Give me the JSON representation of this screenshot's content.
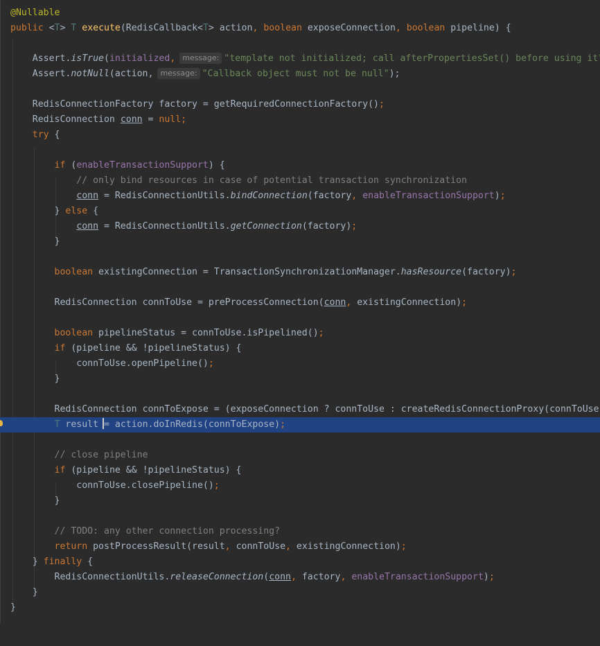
{
  "editor": {
    "language": "Java",
    "highlighted_line": 28,
    "colors": {
      "background": "#2b2b2b",
      "highlight": "#214283",
      "keyword": "#cc7832",
      "annotation": "#bbb529",
      "method_decl": "#ffc66d",
      "field": "#9876aa",
      "string": "#6a8759",
      "comment": "#808080",
      "type_param": "#507874"
    }
  },
  "code": {
    "l1": {
      "annotation": "@Nullable"
    },
    "l2": {
      "kw_public": "public",
      "lt": " <",
      "tp1": "T",
      "gt": "> ",
      "tp2": "T",
      "sp": " ",
      "method": "execute",
      "p1": "(RedisCallback<",
      "tp3": "T",
      "p2": "> action",
      "c1": ", ",
      "kw_boolean1": "boolean",
      "p3": " exposeConnection",
      "c2": ", ",
      "kw_boolean2": "boolean",
      "p4": " pipeline) {"
    },
    "l4": {
      "a": "Assert.",
      "method": "isTrue",
      "b": "(",
      "field": "initialized",
      "c": ",",
      "hint": "message:",
      "str": "\"template not initialized; call afterPropertiesSet() before using it\"",
      "d": ");"
    },
    "l5": {
      "a": "Assert.",
      "method": "notNull",
      "b": "(action,",
      "hint": "message:",
      "str": "\"Callback object must not be null\"",
      "d": ");"
    },
    "l7": {
      "a": "RedisConnectionFactory factory = getRequiredConnectionFactory()",
      "semi": ";"
    },
    "l8": {
      "a": "RedisConnection ",
      "var": "conn",
      "b": " = ",
      "kw_null": "null",
      "semi": ";"
    },
    "l9": {
      "kw_try": "try",
      "b": " {"
    },
    "l11": {
      "kw_if": "if",
      "a": " (",
      "field": "enableTransactionSupport",
      "b": ") {"
    },
    "l12": {
      "comment": "// only bind resources in case of potential transaction synchronization"
    },
    "l13": {
      "var": "conn",
      "a": " = RedisConnectionUtils.",
      "method": "bindConnection",
      "b": "(factory",
      "c": ", ",
      "field": "enableTransactionSupport",
      "d": ")",
      "semi": ";"
    },
    "l14": {
      "a": "} ",
      "kw_else": "else",
      "b": " {"
    },
    "l15": {
      "var": "conn",
      "a": " = RedisConnectionUtils.",
      "method": "getConnection",
      "b": "(factory)",
      "semi": ";"
    },
    "l16": {
      "a": "}"
    },
    "l18": {
      "kw_boolean": "boolean",
      "a": " existingConnection = TransactionSynchronizationManager.",
      "method": "hasResource",
      "b": "(factory)",
      "semi": ";"
    },
    "l20": {
      "a": "RedisConnection connToUse = preProcessConnection(",
      "var": "conn",
      "c": ", ",
      "b": "existingConnection)",
      "semi": ";"
    },
    "l22": {
      "kw_boolean": "boolean",
      "a": " pipelineStatus = connToUse.isPipelined()",
      "semi": ";"
    },
    "l23": {
      "kw_if": "if",
      "a": " (pipeline && !pipelineStatus) {"
    },
    "l24": {
      "a": "connToUse.openPipeline()",
      "semi": ";"
    },
    "l25": {
      "a": "}"
    },
    "l27": {
      "a": "RedisConnection connToExpose = (exposeConnection ? connToUse : createRedisConnectionProxy(connToUse))",
      "semi": ";"
    },
    "l28": {
      "tp": "T",
      "a": " result ",
      "b": "= action.doInRedis(connToExpose)",
      "semi": ";"
    },
    "l30": {
      "comment": "// close pipeline"
    },
    "l31": {
      "kw_if": "if",
      "a": " (pipeline && !pipelineStatus) {"
    },
    "l32": {
      "a": "connToUse.closePipeline()",
      "semi": ";"
    },
    "l33": {
      "a": "}"
    },
    "l35": {
      "comment": "// TODO: any other connection processing?"
    },
    "l36": {
      "kw_return": "return",
      "a": " postProcessResult(result",
      "c1": ", ",
      "b": "connToUse",
      "c2": ", ",
      "d": "existingConnection)",
      "semi": ";"
    },
    "l37": {
      "a": "} ",
      "kw_finally": "finally",
      "b": " {"
    },
    "l38": {
      "a": "RedisConnectionUtils.",
      "method": "releaseConnection",
      "b": "(",
      "var": "conn",
      "c1": ", ",
      "d": "factory",
      "c2": ", ",
      "field": "enableTransactionSupport",
      "e": ")",
      "semi": ";"
    },
    "l39": {
      "a": "}"
    },
    "l40": {
      "a": "}"
    }
  }
}
